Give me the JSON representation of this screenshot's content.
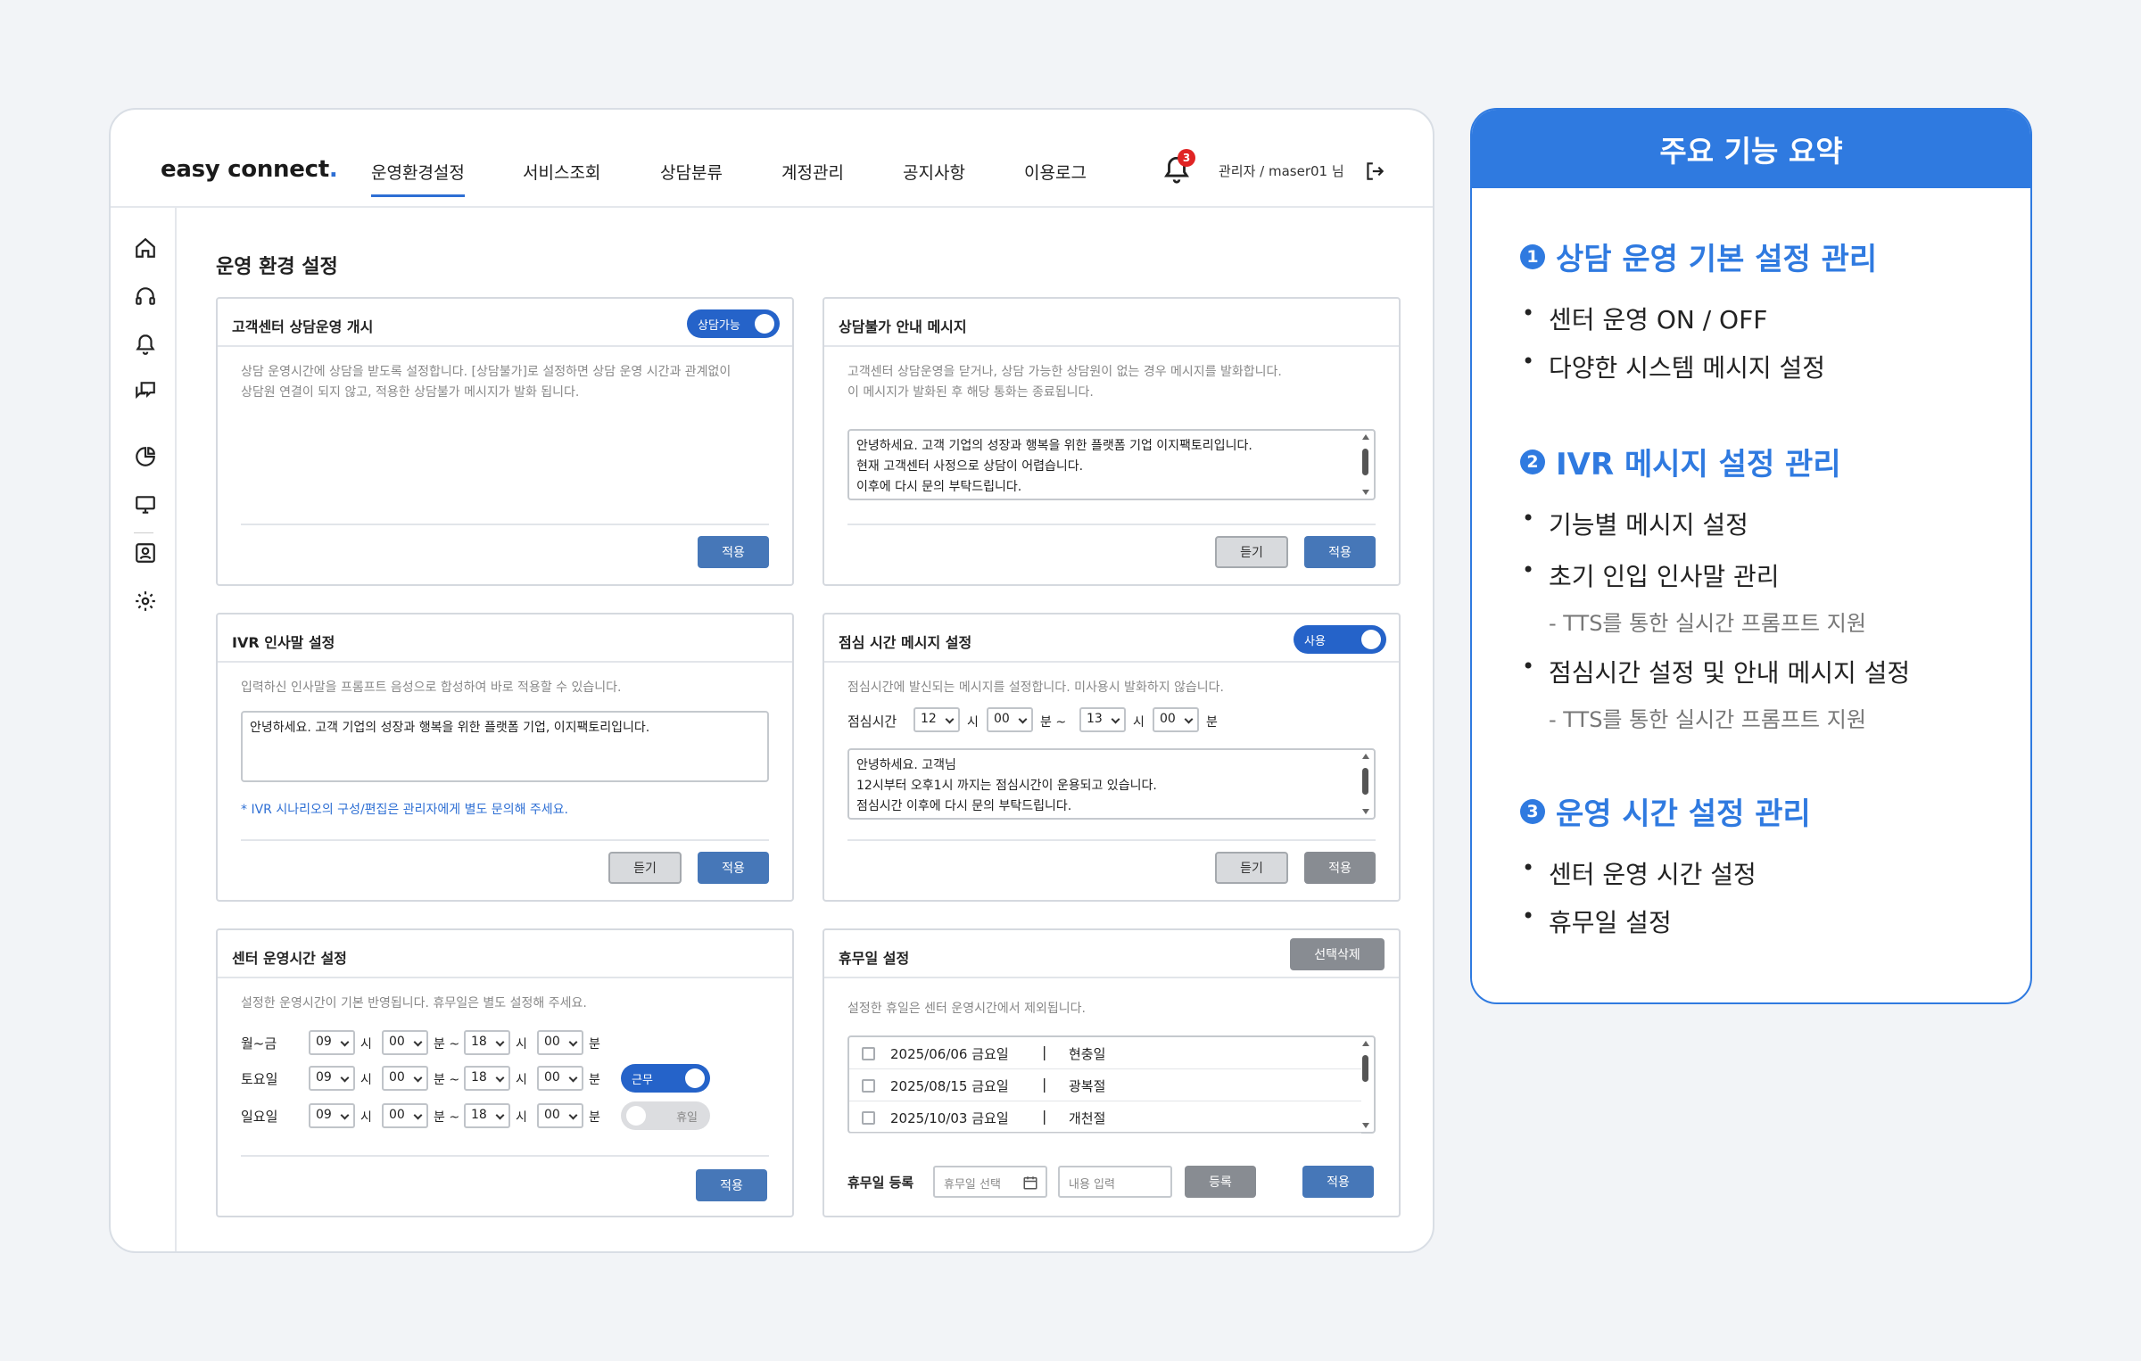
{
  "app": {
    "logo_text": "easy connect",
    "logo_dot": ".",
    "nav": [
      "운영환경설정",
      "서비스조회",
      "상담분류",
      "계정관리",
      "공지사항",
      "이용로그"
    ],
    "notification_count": "3",
    "user_label": "관리자 / maser01 님",
    "page_title": "운영 환경 설정",
    "accent_color": "#2e6fd4"
  },
  "panels": {
    "consult_open": {
      "title": "고객센터 상담운영 개시",
      "toggle_label": "상담가능",
      "desc1": "상담 운영시간에 상담을 받도록 설정합니다. [상담불가]로 설정하면 상담 운영 시간과 관계없이",
      "desc2": "상담원 연결이 되지 않고, 적용한 상담불가 메시지가 발화 됩니다.",
      "apply": "적용"
    },
    "unavailable_msg": {
      "title": "상담불가 안내 메시지",
      "desc1": "고객센터 상담운영을 닫거나, 상담 가능한 상담원이 없는 경우 메시지를 발화합니다.",
      "desc2": "이 메시지가 발화된 후 해당 통화는 종료됩니다.",
      "line1": "안녕하세요. 고객 기업의 성장과 행복을 위한 플랫폼 기업 이지팩토리입니다.",
      "line2": "현재 고객센터 사정으로 상담이 어렵습니다.",
      "line3": "이후에 다시 문의 부탁드립니다.",
      "listen": "듣기",
      "apply": "적용"
    },
    "ivr_greeting": {
      "title": "IVR 인사말 설정",
      "desc": "입력하신 인사말을 프롬프트 음성으로 합성하여 바로 적용할 수 있습니다.",
      "text": "안녕하세요. 고객 기업의 성장과 행복을 위한 플랫폼 기업, 이지팩토리입니다.",
      "note": "* IVR 시나리오의 구성/편집은 관리자에게 별도 문의해 주세요.",
      "listen": "듣기",
      "apply": "적용"
    },
    "lunch_msg": {
      "title": "점심 시간 메시지 설정",
      "toggle_label": "사용",
      "desc": "점심시간에 발신되는 메시지를 설정합니다. 미사용시 발화하지 않습니다.",
      "time_label": "점심시간",
      "start_h": "12",
      "start_m": "00",
      "end_h": "13",
      "end_m": "00",
      "unit_h": "시",
      "unit_m": "분",
      "unit_m_tilde": "분 ~",
      "line1": "안녕하세요. 고객님",
      "line2": "12시부터 오후1시 까지는 점심시간이 운용되고 있습니다.",
      "line3": "점심시간 이후에 다시 문의 부탁드립니다.",
      "listen": "듣기",
      "apply": "적용"
    },
    "hours": {
      "title": "센터 운영시간 설정",
      "desc": "설정한 운영시간이 기본 반영됩니다. 휴무일은 별도 설정해 주세요.",
      "rows": [
        {
          "label": "월~금",
          "sh": "09",
          "sm": "00",
          "eh": "18",
          "em": "00"
        },
        {
          "label": "토요일",
          "sh": "09",
          "sm": "00",
          "eh": "18",
          "em": "00",
          "toggle": "근무"
        },
        {
          "label": "일요일",
          "sh": "09",
          "sm": "00",
          "eh": "18",
          "em": "00",
          "toggle": "휴일"
        }
      ],
      "unit_h": "시",
      "unit_m": "분",
      "unit_m_tilde": "분 ~",
      "apply": "적용"
    },
    "holidays": {
      "title": "휴무일 설정",
      "delete_selected": "선택삭제",
      "desc": "설정한 휴일은 센터 운영시간에서 제외됩니다.",
      "items": [
        {
          "date": "2025/06/06 금요일",
          "name": "현충일"
        },
        {
          "date": "2025/08/15 금요일",
          "name": "광복절"
        },
        {
          "date": "2025/10/03 금요일",
          "name": "개천절"
        }
      ],
      "sep": "|",
      "register_label": "휴무일 등록",
      "date_placeholder": "휴무일 선택",
      "content_placeholder": "내용 입력",
      "register": "등록",
      "apply": "적용"
    }
  },
  "summary": {
    "title": "주요 기능 요약",
    "accent_color": "#2f7ae0",
    "sections": [
      {
        "num": "1",
        "title": "상담 운영 기본 설정 관리",
        "items": [
          "센터 운영 ON / OFF",
          "다양한 시스템 메시지 설정"
        ]
      },
      {
        "num": "2",
        "title": "IVR 메시지 설정 관리",
        "items": [
          "기능별 메시지 설정",
          "초기 인입 인사말 관리",
          "- TTS를 통한 실시간 프롬프트 지원",
          "점심시간 설정 및 안내 메시지 설정",
          "- TTS를 통한 실시간 프롬프트 지원"
        ]
      },
      {
        "num": "3",
        "title": "운영 시간 설정 관리",
        "items": [
          "센터 운영 시간 설정",
          "휴무일 설정"
        ]
      }
    ]
  }
}
